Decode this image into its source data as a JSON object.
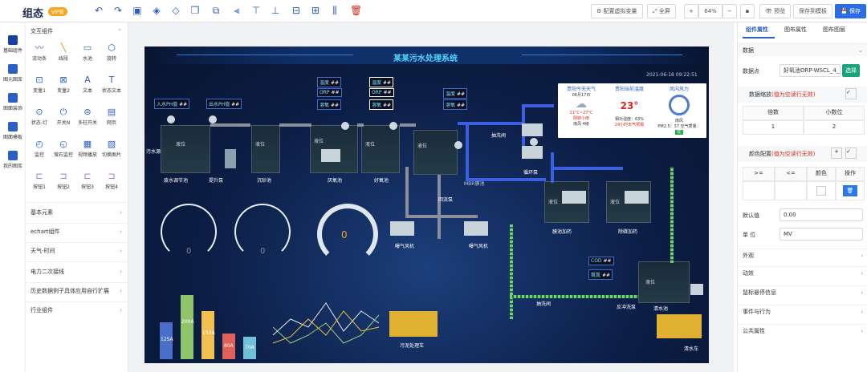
{
  "app": {
    "brand": "组态",
    "version": "VIP版"
  },
  "toolbar": {
    "virtual_var": "配置虚拟变量",
    "fullscreen": "全屏",
    "zoom": "64%",
    "preview": "预览",
    "save_template": "保存到模板",
    "save": "保存"
  },
  "left_nav": {
    "items": [
      "基础组件",
      "图元图库",
      "图面装饰",
      "图面模板",
      "我的图库"
    ]
  },
  "panel": {
    "section_interactive": "交互组件",
    "components": [
      "流动条",
      "线段",
      "水池",
      "旋转",
      "变量1",
      "变量2",
      "文本",
      "状态文本",
      "状态-灯",
      "开关N",
      "多柱开关",
      "网页",
      "监控",
      "萤石监控",
      "视频播放",
      "切换图片",
      "按钮1",
      "按钮2",
      "按钮3",
      "按钮4"
    ],
    "sections": [
      "基本元素",
      "echart组件",
      "天气-时间",
      "电力二次接线",
      "历史数据例子具体应用自行扩展",
      "行业组件"
    ]
  },
  "canvas": {
    "title": "某某污水处理系统",
    "datetime": "2021-06-18 09:22:51",
    "labels": {
      "inflow_ph": "入水PH值",
      "outflow_ph": "出水PH值",
      "temp1": "温度",
      "orp1": "ORP",
      "do1": "溶氧",
      "temp2": "温度",
      "orp2": "ORP",
      "do2": "溶氧",
      "temp3": "温度",
      "do3": "溶氧",
      "sewage_in": "污水源",
      "regulate": "废水调节池",
      "lift": "提升泵",
      "settle": "沉砂池",
      "anoxic": "厌氧池",
      "aerobic": "好氧池",
      "return_tank": "回流泵",
      "mbr": "MBR膜池",
      "pump1": "抽洗阀",
      "pump2": "循环泵",
      "dosing": "膜池加药",
      "disinfect": "除磷加药",
      "blower1": "曝气风机",
      "blower2": "曝气风机",
      "cod": "COD",
      "nh": "氨氮",
      "backwash": "反冲洗泵",
      "drain": "抽洗阀",
      "clear": "清水池",
      "mud_truck": "污泥处理车",
      "water_truck": "清水车",
      "level": "液位",
      "val_dots": "##"
    },
    "weather": {
      "today_title": "贵阳今天天气",
      "date": "06月17日",
      "temp": "21°C~27°C",
      "desc": "阴转小雨",
      "wind": "南风 4级",
      "tank_title": "贵阳当前温度",
      "tank_temp": "23°",
      "humid": "相对湿度：63%",
      "update": "24小时天气预报",
      "wind_title": "风向风力",
      "wind_dir": "南风",
      "pm": "PM2.5：",
      "pm_val": "37",
      "aqi": "空气质量：",
      "aqi_val": "优"
    },
    "gauge1_value": "0",
    "gauge2_value": "0",
    "gauge3_value": "0",
    "bars": {
      "values": [
        "125A",
        "200A",
        "150A",
        "80A",
        "70A"
      ]
    }
  },
  "right": {
    "tabs": [
      "组件属性",
      "图布属性",
      "图布图层"
    ],
    "data_section": "数据",
    "datapoint_label": "数据点",
    "datapoint_value": "好氧池ORP-WSCL_4_",
    "select_btn": "选择",
    "zoom_label": "数据缩放",
    "zoom_hint": "(值为空读行无效)",
    "col_mult": "倍数",
    "col_decimal": "小数位",
    "mult_val": "1",
    "decimal_val": "2",
    "color_cfg": "颜色配置",
    "color_hint": "(值为空读行无效)",
    "col_ge": ">=",
    "col_le": "<=",
    "col_color": "颜色",
    "col_op": "操作",
    "default_label": "默认值",
    "default_val": "0.00",
    "unit_label": "单 位",
    "unit_val": "MV",
    "acc": [
      "外观",
      "动效",
      "鼠标悬停信息",
      "事件与行为",
      "公共属性"
    ]
  }
}
